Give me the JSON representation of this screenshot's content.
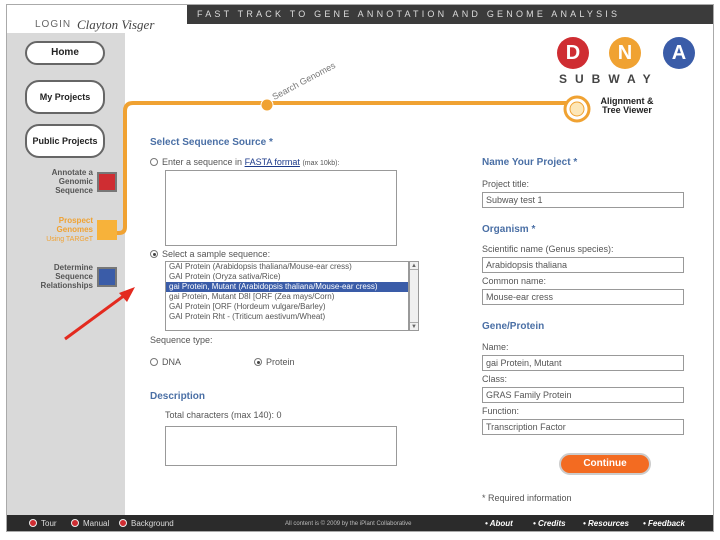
{
  "header": {
    "banner": "FAST TRACK TO GENE ANNOTATION AND GENOME ANALYSIS",
    "login_label": "LOGIN",
    "login_name": "Clayton Visger"
  },
  "nav": {
    "home": "Home",
    "my_projects": "My Projects",
    "public_projects": "Public Projects"
  },
  "tasks": {
    "annotate": "Annotate a Genomic Sequence",
    "prospect": "Prospect Genomes",
    "prospect_sub": "Using TARGeT",
    "determine": "Determine Sequence Relationships"
  },
  "logo": {
    "d": "D",
    "n": "N",
    "a": "A",
    "subway": "SUBWAY"
  },
  "stations": {
    "search": "Search Genomes",
    "alignment": "Alignment & Tree Viewer"
  },
  "source": {
    "title": "Select Sequence Source *",
    "paste_prefix": "Enter a sequence in",
    "paste_link": "FASTA format",
    "paste_suffix": "(max 10kb):",
    "sample_label": "Select a sample sequence:",
    "samples": [
      "GAI Protein (Arabidopsis thaliana/Mouse-ear cress)",
      "GAI Protein (Oryza sativa/Rice)",
      "gai Protein, Mutant (Arabidopsis thaliana/Mouse-ear cress)",
      "gai Protein, Mutant D8I [ORF (Zea mays/Corn)",
      "GAI Protein [ORF (Hordeum vulgare/Barley)",
      "GAI Protein Rht - (Triticum aestivum/Wheat)"
    ],
    "selected_index": 2,
    "seq_type_label": "Sequence type:",
    "dna": "DNA",
    "protein": "Protein"
  },
  "description": {
    "title": "Description",
    "counter": "Total characters (max 140): 0"
  },
  "project": {
    "title": "Name Your Project *",
    "label": "Project title:",
    "value": "Subway test 1"
  },
  "organism": {
    "title": "Organism *",
    "sci_label": "Scientific name (Genus species):",
    "sci_value": "Arabidopsis thaliana",
    "common_label": "Common name:",
    "common_value": "Mouse-ear cress"
  },
  "gene": {
    "title": "Gene/Protein",
    "name_label": "Name:",
    "name_value": "gai Protein, Mutant",
    "class_label": "Class:",
    "class_value": "GRAS Family Protein",
    "function_label": "Function:",
    "function_value": "Transcription Factor"
  },
  "actions": {
    "continue": "Continue",
    "required_note": "* Required information"
  },
  "footer": {
    "tour": "Tour",
    "manual": "Manual",
    "background": "Background",
    "copyright": "All content is © 2009 by the iPlant Collaborative",
    "about": "About",
    "credits": "Credits",
    "resources": "Resources",
    "feedback": "Feedback"
  },
  "colors": {
    "red": "#cf2d32",
    "orange": "#f0a232",
    "blue": "#3a5ca8",
    "accent": "#f36b21"
  }
}
